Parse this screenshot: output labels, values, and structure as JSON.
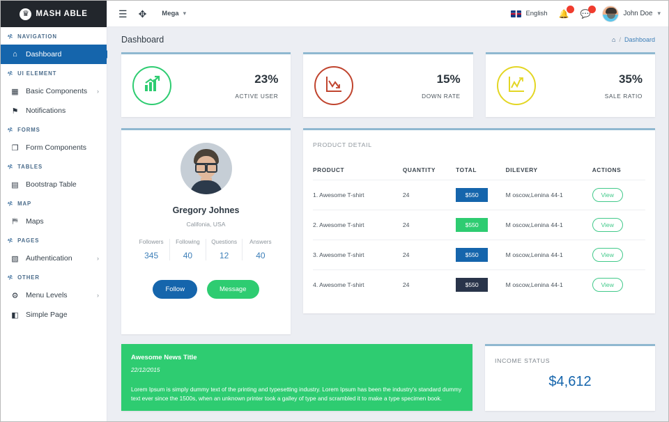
{
  "brand": {
    "name": "MASH ABLE",
    "logo_icon": "castle-logo-icon"
  },
  "sidebar": {
    "sections": [
      {
        "title": "NAVIGATION",
        "items": [
          {
            "label": "Dashboard",
            "icon": "home-icon",
            "active": true,
            "caret": false
          }
        ]
      },
      {
        "title": "UI ELEMENT",
        "items": [
          {
            "label": "Basic Components",
            "icon": "grid-icon",
            "active": false,
            "caret": true
          },
          {
            "label": "Notifications",
            "icon": "bell-alert-icon",
            "active": false,
            "caret": false
          }
        ]
      },
      {
        "title": "FORMS",
        "items": [
          {
            "label": "Form Components",
            "icon": "form-icon",
            "active": false,
            "caret": false
          }
        ]
      },
      {
        "title": "TABLES",
        "items": [
          {
            "label": "Bootstrap Table",
            "icon": "table-icon",
            "active": false,
            "caret": false
          }
        ]
      },
      {
        "title": "MAP",
        "items": [
          {
            "label": "Maps",
            "icon": "map-icon",
            "active": false,
            "caret": false
          }
        ]
      },
      {
        "title": "PAGES",
        "items": [
          {
            "label": "Authentication",
            "icon": "id-card-icon",
            "active": false,
            "caret": true
          }
        ]
      },
      {
        "title": "OTHER",
        "items": [
          {
            "label": "Menu Levels",
            "icon": "sitemap-icon",
            "active": false,
            "caret": true
          },
          {
            "label": "Simple Page",
            "icon": "page-icon",
            "active": false,
            "caret": false
          }
        ]
      }
    ]
  },
  "header": {
    "menu_icon": "hamburger-icon",
    "expand_icon": "expand-arrows-icon",
    "mega_label": "Mega",
    "mega_caret": "chevron-down-icon",
    "language": "English",
    "language_flag": "uk-flag-icon",
    "bell_icon": "bell-icon",
    "chat_icon": "comment-icon",
    "user_name": "John Doe",
    "user_caret": "chevron-down-icon",
    "avatar_icon": "user-avatar"
  },
  "page": {
    "title": "Dashboard",
    "breadcrumb_home_icon": "home-icon",
    "breadcrumb_sep": "/",
    "breadcrumb_current": "Dashboard"
  },
  "stats": [
    {
      "value": "23%",
      "label": "ACTIVE USER",
      "color": "#2ecc71",
      "icon": "bar-chart-up-icon"
    },
    {
      "value": "15%",
      "label": "DOWN RATE",
      "color": "#c0442e",
      "icon": "line-chart-down-icon"
    },
    {
      "value": "35%",
      "label": "SALE RATIO",
      "color": "#e3d624",
      "icon": "line-chart-up-icon"
    }
  ],
  "profile": {
    "name": "Gregory Johnes",
    "location": "Califonia, USA",
    "stats": [
      {
        "label": "Followers",
        "value": "345"
      },
      {
        "label": "Following",
        "value": "40"
      },
      {
        "label": "Questions",
        "value": "12"
      },
      {
        "label": "Answers",
        "value": "40"
      }
    ],
    "follow_label": "Follow",
    "message_label": "Message"
  },
  "product_table": {
    "title": "PRODUCT DETAIL",
    "columns": [
      "PRODUCT",
      "QUANTITY",
      "TOTAL",
      "DILEVERY",
      "ACTIONS"
    ],
    "action_label": "View",
    "rows": [
      {
        "product": "1. Awesome T-shirt",
        "quantity": "24",
        "total": "$550",
        "total_color": "#1565ac",
        "dilevery": "M oscow,Lenina 44-1"
      },
      {
        "product": "2. Awesome T-shirt",
        "quantity": "24",
        "total": "$550",
        "total_color": "#2ecc71",
        "dilevery": "M oscow,Lenina 44-1"
      },
      {
        "product": "3. Awesome T-shirt",
        "quantity": "24",
        "total": "$550",
        "total_color": "#1565ac",
        "dilevery": "M oscow,Lenina 44-1"
      },
      {
        "product": "4. Awesome T-shirt",
        "quantity": "24",
        "total": "$550",
        "total_color": "#29344a",
        "dilevery": "M oscow,Lenina 44-1"
      }
    ]
  },
  "news": {
    "title": "Awesome News Title",
    "date": "22/12/2015",
    "body": "Lorem Ipsum is simply dummy text of the printing and typesetting industry. Lorem Ipsum has been the industry's standard dummy text ever since the 1500s, when an unknown printer took a galley of type and scrambled it to make a type specimen book.",
    "background": "#2ecc71"
  },
  "income": {
    "label": "INCOME STATUS",
    "value": "$4,612",
    "color": "#1565ac"
  }
}
